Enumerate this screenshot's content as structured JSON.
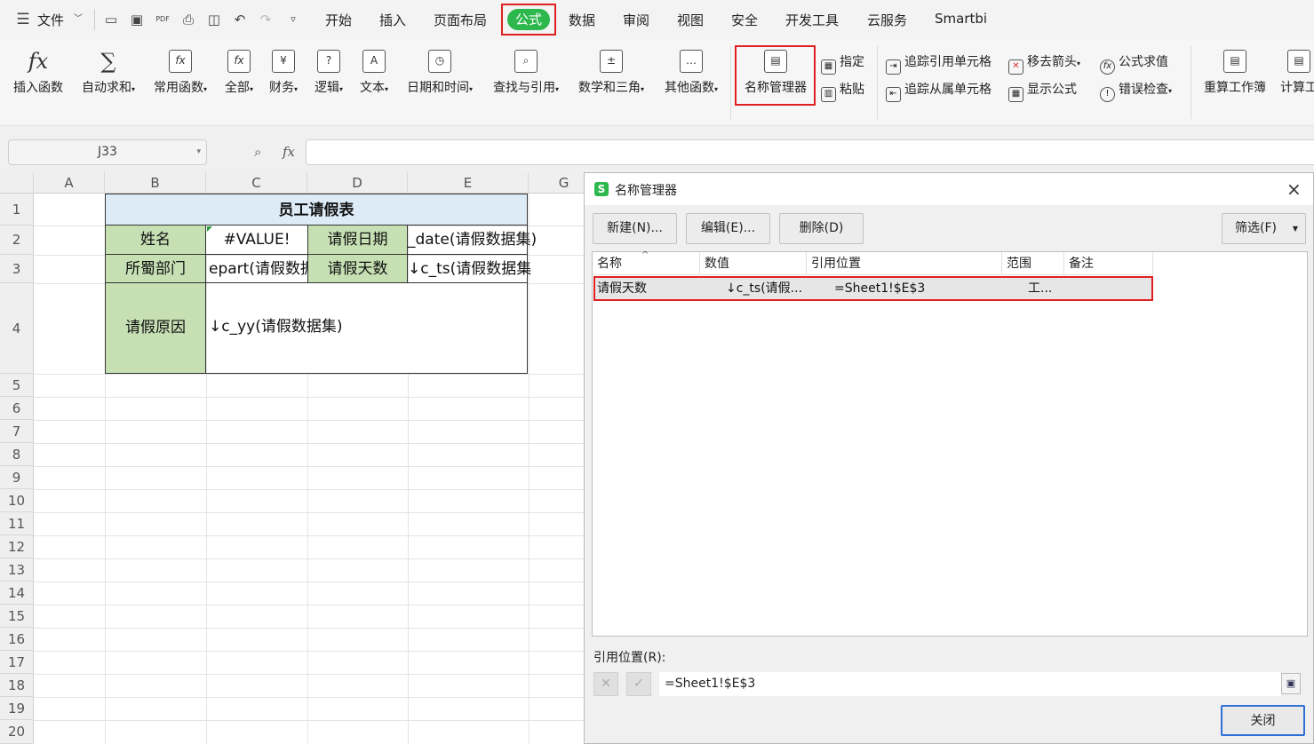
{
  "menu": {
    "file": "文件",
    "tabs": [
      "开始",
      "插入",
      "页面布局",
      "公式",
      "数据",
      "审阅",
      "视图",
      "安全",
      "开发工具",
      "云服务",
      "Smartbi"
    ],
    "active_tab": "公式"
  },
  "ribbon": {
    "insert_function": "插入函数",
    "autosum": "自动求和",
    "common_functions": "常用函数",
    "all": "全部",
    "finance": "财务",
    "logic": "逻辑",
    "text": "文本",
    "datetime": "日期和时间",
    "lookup": "查找与引用",
    "math": "数学和三角",
    "other": "其他函数",
    "name_manager": "名称管理器",
    "specify": "指定",
    "paste": "粘贴",
    "trace_precedents": "追踪引用单元格",
    "trace_dependents": "追踪从属单元格",
    "remove_arrows": "移去箭头",
    "show_formulas": "显示公式",
    "evaluate_formula": "公式求值",
    "error_check": "错误检查",
    "recalc_workbook": "重算工作簿",
    "calc_partial": "计算工"
  },
  "formula_bar": {
    "cell_ref": "J33",
    "fx": "fx",
    "content": ""
  },
  "sheet": {
    "columns": [
      "A",
      "B",
      "C",
      "D",
      "E",
      "G"
    ],
    "rows": [
      "1",
      "2",
      "3",
      "4",
      "5",
      "6",
      "7",
      "8",
      "9",
      "10",
      "11",
      "12",
      "13",
      "14",
      "15",
      "16",
      "17",
      "18",
      "19",
      "20"
    ],
    "title": "员工请假表",
    "label_name": "姓名",
    "value_name": "#VALUE!",
    "label_date": "请假日期",
    "value_date": "_date(请假数据集)",
    "label_dept": "所蜀部门",
    "value_dept": "epart(请假数据",
    "label_days": "请假天数",
    "value_days": "↓c_ts(请假数据集)",
    "label_reason": "请假原因",
    "value_reason": "↓c_yy(请假数据集)"
  },
  "dialog": {
    "title": "名称管理器",
    "new_button": "新建(N)...",
    "edit_button": "编辑(E)...",
    "delete_button": "删除(D)",
    "filter_button": "筛选(F)",
    "headers": [
      "名称",
      "数值",
      "引用位置",
      "范围",
      "备注"
    ],
    "rows": [
      {
        "name": "请假天数",
        "value": "↓c_ts(请假...",
        "ref": "=Sheet1!$E$3",
        "scope": "工...",
        "comment": ""
      }
    ],
    "refers_to_label": "引用位置(R):",
    "refers_to_value": "=Sheet1!$E$3",
    "close_button": "关闭"
  }
}
